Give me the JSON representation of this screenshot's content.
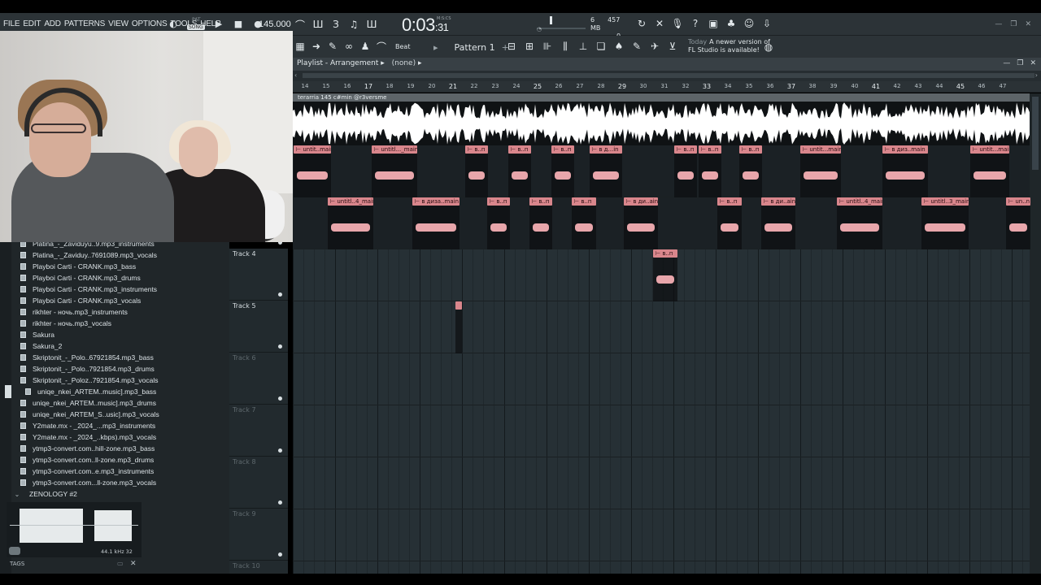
{
  "menu": [
    "FILE",
    "EDIT",
    "ADD",
    "PATTERNS",
    "VIEW",
    "OPTIONS",
    "TOOLS",
    "HELP"
  ],
  "transport": {
    "mode_pat": "PAT",
    "mode_song": "SONG",
    "tempo": "145.000",
    "time_main": "0:03",
    "time_sub": "31",
    "time_unit": "M:S:CS"
  },
  "cpu": {
    "cpu_value": "6",
    "ram": "457 MB",
    "poly": "0"
  },
  "toolbar2": {
    "snap_label": "Beat",
    "pattern_label": "Pattern 1",
    "news_today": "Today",
    "news_line1": "A newer version of",
    "news_line2": "FL Studio is available!"
  },
  "playlist": {
    "title": "Playlist - Arrangement",
    "arrangement": "(none)",
    "ruler_ticks": [
      "14",
      "15",
      "16",
      "17",
      "18",
      "19",
      "20",
      "21",
      "22",
      "23",
      "24",
      "25",
      "26",
      "27",
      "28",
      "29",
      "30",
      "31",
      "32",
      "33",
      "34",
      "35",
      "36",
      "37",
      "38",
      "39",
      "40",
      "41",
      "42",
      "43",
      "44",
      "45",
      "46",
      "47"
    ],
    "top_clip_label": "terarria 145 c#min @r3versme"
  },
  "clips_row2": [
    {
      "label": "untit..main"
    },
    {
      "label": "untitl..._main"
    },
    {
      "label": "в..п"
    },
    {
      "label": "в..п"
    },
    {
      "label": "в..п"
    },
    {
      "label": "в д...in"
    },
    {
      "label": "в..п"
    },
    {
      "label": "в..п"
    },
    {
      "label": "в..п"
    },
    {
      "label": "untit...main"
    },
    {
      "label": "в диз..main"
    },
    {
      "label": "untit...main"
    }
  ],
  "clips_row3": [
    {
      "label": "untitl..4_main"
    },
    {
      "label": "в диза..main"
    },
    {
      "label": "в..п"
    },
    {
      "label": "в..п"
    },
    {
      "label": "в..п"
    },
    {
      "label": "в ди..ain"
    },
    {
      "label": "в..п"
    },
    {
      "label": "в ди..ain"
    },
    {
      "label": "untitl..4_main"
    },
    {
      "label": "untitl..3_main"
    },
    {
      "label": "un..n"
    }
  ],
  "clips_row4": [
    {
      "label": "в..п"
    }
  ],
  "tracks": [
    {
      "name": "Track 4"
    },
    {
      "name": "Track 5"
    },
    {
      "name": "Track 6"
    },
    {
      "name": "Track 7"
    },
    {
      "name": "Track 8"
    },
    {
      "name": "Track 9"
    },
    {
      "name": "Track 10"
    }
  ],
  "browser_items": [
    {
      "label": "Platina_-_Zaviduyu..9.mp3_instruments",
      "type": "file"
    },
    {
      "label": "Platina_-_Zaviduy..7691089.mp3_vocals",
      "type": "file"
    },
    {
      "label": "Playboi Carti - CRANK.mp3_bass",
      "type": "file"
    },
    {
      "label": "Playboi Carti - CRANK.mp3_drums",
      "type": "file"
    },
    {
      "label": "Playboi Carti - CRANK.mp3_instruments",
      "type": "file"
    },
    {
      "label": "Playboi Carti - CRANK.mp3_vocals",
      "type": "file"
    },
    {
      "label": "rikhter - ночь.mp3_instruments",
      "type": "file"
    },
    {
      "label": "rikhter - ночь.mp3_vocals",
      "type": "file"
    },
    {
      "label": "Sakura",
      "type": "file"
    },
    {
      "label": "Sakura_2",
      "type": "file"
    },
    {
      "label": "Skriptonit_-_Polo..67921854.mp3_bass",
      "type": "file"
    },
    {
      "label": "Skriptonit_-_Polo..7921854.mp3_drums",
      "type": "file"
    },
    {
      "label": "Skriptonit_-_Poloz..7921854.mp3_vocals",
      "type": "file"
    },
    {
      "label": "uniqe_nkei_ARTEM..music].mp3_bass",
      "type": "file-selected"
    },
    {
      "label": "uniqe_nkei_ARTEM..music].mp3_drums",
      "type": "file"
    },
    {
      "label": "uniqe_nkei_ARTEM_S..usic].mp3_vocals",
      "type": "file"
    },
    {
      "label": "Y2mate.mx - _2024_...mp3_instruments",
      "type": "file"
    },
    {
      "label": "Y2mate.mx - _2024_..kbps).mp3_vocals",
      "type": "file"
    },
    {
      "label": "ytmp3-convert.com..hill-zone.mp3_bass",
      "type": "file"
    },
    {
      "label": "ytmp3-convert.com..ll-zone.mp3_drums",
      "type": "file"
    },
    {
      "label": "ytmp3-convert.com..e.mp3_instruments",
      "type": "file"
    },
    {
      "label": "ytmp3-convert.com...ll-zone.mp3_vocals",
      "type": "file"
    },
    {
      "label": "ZENOLOGY #2",
      "type": "folder"
    }
  ],
  "preview": {
    "freq": "44.1 kHz 32"
  },
  "tags_label": "TAGS",
  "colors": {
    "clip": "#d9868c",
    "playlist_bg": "#263035",
    "toolbar": "#2c3337"
  }
}
